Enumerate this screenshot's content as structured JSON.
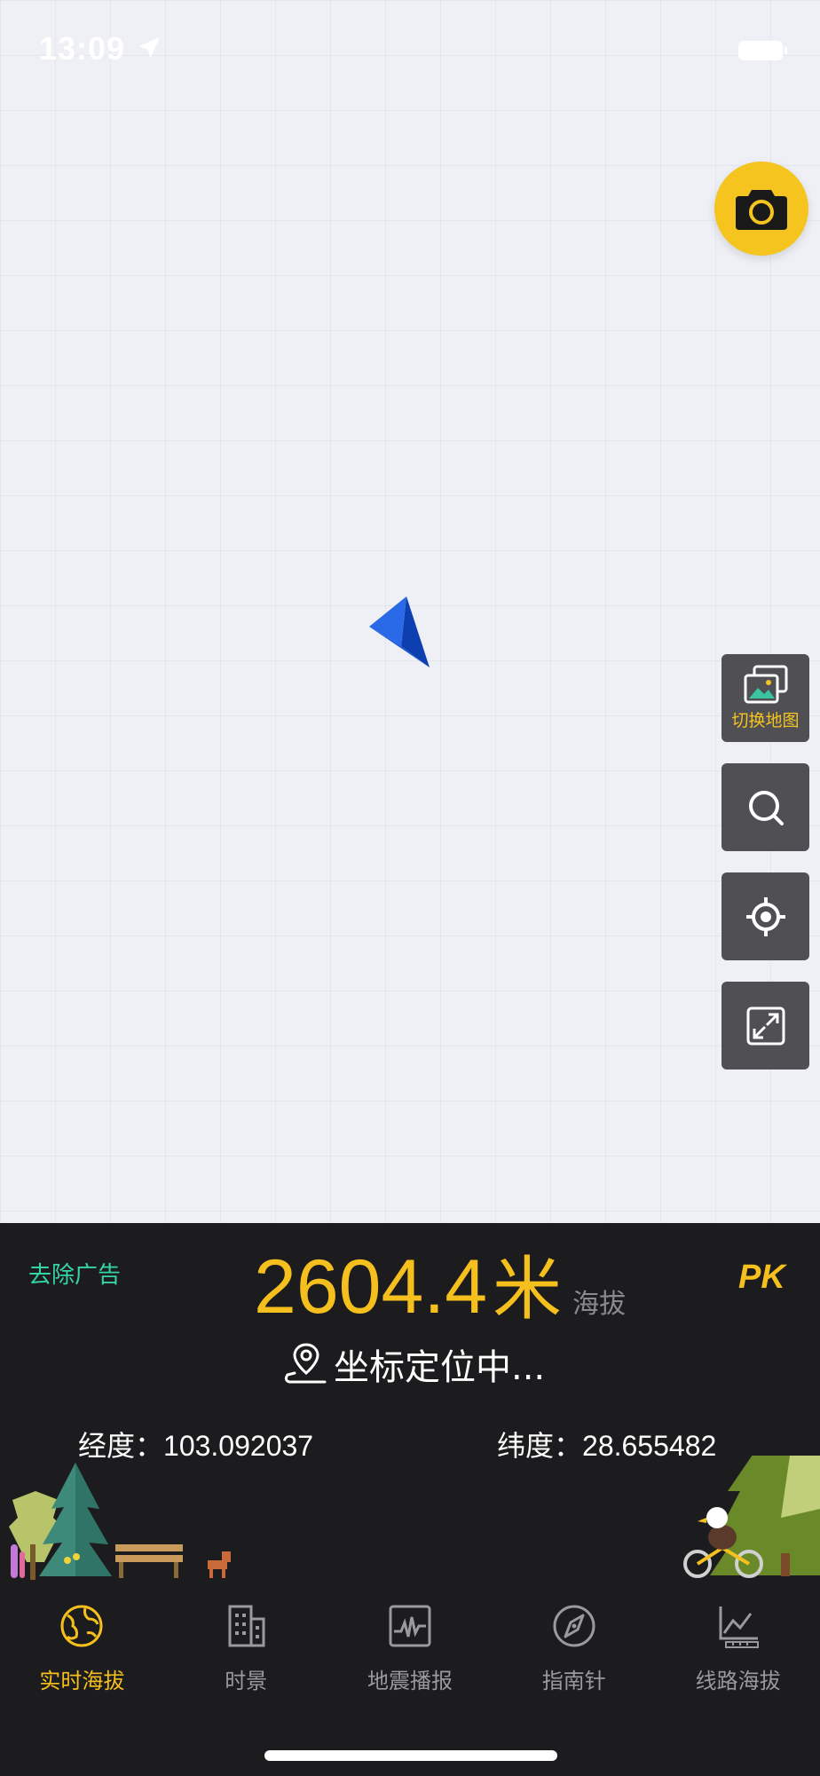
{
  "status": {
    "time": "13:09"
  },
  "map": {
    "camera_icon": "camera-icon",
    "tools": [
      {
        "name": "switch-map-button",
        "icon": "gallery-icon",
        "label": "切换地图"
      },
      {
        "name": "search-button",
        "icon": "search-icon",
        "label": ""
      },
      {
        "name": "locate-button",
        "icon": "locate-icon",
        "label": ""
      },
      {
        "name": "fullscreen-button",
        "icon": "expand-icon",
        "label": ""
      }
    ]
  },
  "panel": {
    "remove_ad": "去除广告",
    "altitude_value": "2604.4",
    "altitude_unit": "米",
    "altitude_label": "海拔",
    "pk_label": "PK",
    "location_status": "坐标定位中...",
    "longitude_label": "经度：",
    "longitude_value": "103.092037",
    "latitude_label": "纬度：",
    "latitude_value": "28.655482"
  },
  "tabs": [
    {
      "label": "实时海拔",
      "icon": "globe-icon",
      "active": true
    },
    {
      "label": "时景",
      "icon": "building-icon",
      "active": false
    },
    {
      "label": "地震播报",
      "icon": "seismograph-icon",
      "active": false
    },
    {
      "label": "指南针",
      "icon": "compass-icon",
      "active": false
    },
    {
      "label": "线路海拔",
      "icon": "route-chart-icon",
      "active": false
    }
  ],
  "colors": {
    "accent": "#f5bf1d",
    "ad_green": "#35d4a6",
    "panel_bg": "#1c1c1e",
    "tool_bg": "#4f4f54",
    "nav_arrow": "#1a56d6"
  }
}
